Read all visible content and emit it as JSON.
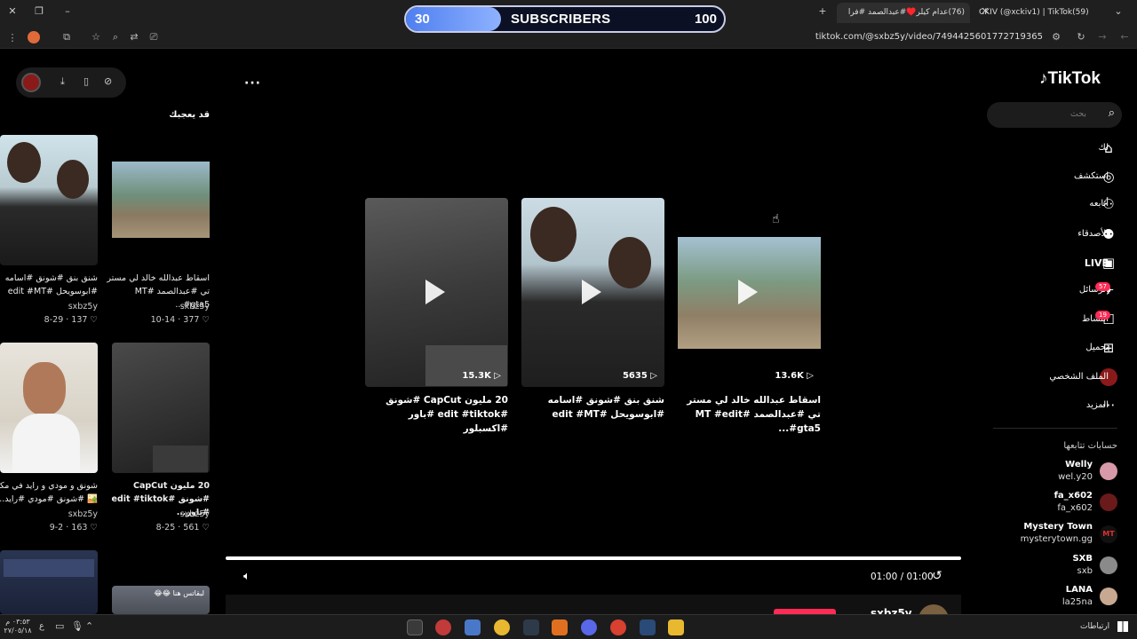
{
  "browser": {
    "tabs": [
      {
        "label": "CKIV (@xckiv1) | TikTok(59)"
      },
      {
        "label": "(76)عدام كيلر♥️#عبدالصمد #فرا"
      }
    ],
    "url": "tiktok.com/@sxbz5y/video/7494425601772719365"
  },
  "overlay": {
    "current": "30",
    "label": "SUBSCRIBERS",
    "goal": "100",
    "progress": 0.3
  },
  "left": {
    "heading": "قد يعجبك",
    "cards": [
      {
        "title": "اسقاط عبدالله خالد لي مستر تي #عبدالصمد #MT #gta5...",
        "user": "sxbz5y",
        "likes": "377",
        "date": "10-14"
      },
      {
        "title": "شنق بنق #شونق #اسامه #ابوسويحل #edit #MT",
        "user": "sxbz5y",
        "likes": "137",
        "date": "8-29"
      },
      {
        "title": "20 مليون CapCut #شونق #edit #tiktok #باور...",
        "user": "sxbz5y",
        "likes": "561",
        "date": "8-25"
      },
      {
        "title": "شونق و مودي و رايد في مكه 🏜️ #شونق #مودي #رايد...",
        "user": "sxbz5y",
        "likes": "163",
        "date": "9-2"
      }
    ],
    "thumb_caption": "لبقاتس هنا 😂😂"
  },
  "center": {
    "videos": [
      {
        "views": "13.6K",
        "title": "اسقاط عبدالله خالد لي مستر تي #عبدالصمد #MT #edit #gta5..."
      },
      {
        "views": "5635",
        "title": "شنق بنق #شونق #اسامه #ابوسويحل #edit #MT"
      },
      {
        "views": "15.3K",
        "title": "20 مليون CapCut #شونق #edit #tiktok #باور #اكسبلور"
      }
    ],
    "time": "01:00 / 01:00",
    "author": "sxbz5y"
  },
  "right": {
    "logo": "TikTok",
    "search_placeholder": "بحث",
    "nav": [
      {
        "label": "لك",
        "icon": "home-icon"
      },
      {
        "label": "استكشف",
        "icon": "compass-icon"
      },
      {
        "label": "أتابعه",
        "icon": "following-icon"
      },
      {
        "label": "الأصدقاء",
        "icon": "friends-icon"
      },
      {
        "label": "LIVE",
        "icon": "live-icon"
      },
      {
        "label": "الرسائل",
        "icon": "messages-icon",
        "badge": "57"
      },
      {
        "label": "النشاط",
        "icon": "activity-icon",
        "badge": "19"
      },
      {
        "label": "تحميل",
        "icon": "upload-icon"
      },
      {
        "label": "الملف الشخصي",
        "icon": "profile-icon"
      },
      {
        "label": "المزيد",
        "icon": "more-icon"
      }
    ],
    "following_heading": "حسابات تتابعها",
    "following": [
      {
        "name": "Welly",
        "handle": "wel.y20"
      },
      {
        "name": "fa_x602",
        "handle": "fa_x602"
      },
      {
        "name": "Mystery Town",
        "handle": "mysterytown.gg"
      },
      {
        "name": "SXB",
        "handle": "sxb"
      },
      {
        "name": "LANA",
        "handle": "la25na"
      }
    ]
  },
  "taskbar": {
    "time": "٠٣:٥٣ م",
    "date": "٢٧/٠٥/١٨",
    "network": "ارتباطات"
  },
  "colors": {
    "accent": "#fe2c55",
    "overlay_fill": "#6b95f5"
  }
}
